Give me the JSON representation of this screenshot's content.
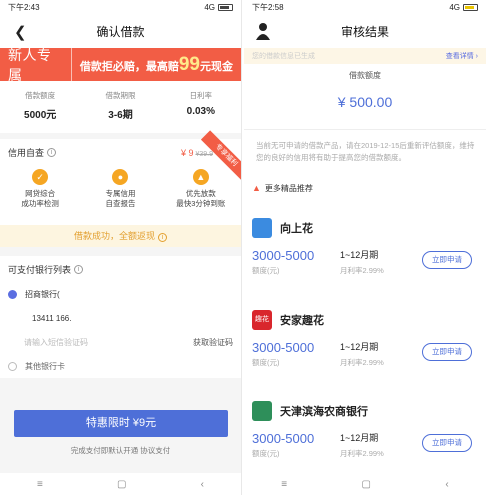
{
  "left": {
    "status": {
      "time": "下午2:43",
      "network": "4G"
    },
    "nav": {
      "title": "确认借款"
    },
    "banner": {
      "tag": "新人专属",
      "msg_prefix": "借款拒必赔，最高赔",
      "msg_amount": "99",
      "msg_suffix": "元现金"
    },
    "stats": [
      {
        "label": "借款额度",
        "value": "5000元"
      },
      {
        "label": "借款期限",
        "value": "3-6期"
      },
      {
        "label": "日利率",
        "value": "0.03%"
      }
    ],
    "credit": {
      "title": "信用自查",
      "price": "¥ 9",
      "old_price": "¥39.9",
      "ribbon": "专享福利",
      "features": [
        {
          "line1": "网贷综合",
          "line2": "成功率检测"
        },
        {
          "line1": "专属信用",
          "line2": "自查报告"
        },
        {
          "line1": "优先放款",
          "line2": "最快3分钟到账"
        }
      ],
      "notice": "借款成功，全额返现"
    },
    "bank": {
      "title": "可支付银行列表",
      "bank_name": "招商银行(",
      "phone": "13411  166.  ",
      "code_placeholder": "请输入短信验证码",
      "get_code": "获取验证码",
      "other": "其他银行卡"
    },
    "pay_button": "特惠限时 ¥9元",
    "agreement": "完成支付即默认开通 协议支付"
  },
  "right": {
    "status": {
      "time": "下午2:58",
      "network": "4G"
    },
    "nav": {
      "title": "审核结果"
    },
    "banner": {
      "left": "您的借款信息已生成",
      "right": "查看详情 ›"
    },
    "amount": {
      "label": "借款额度",
      "value": "¥ 500.00"
    },
    "note": "当前无可申请的借款产品，请在2019-12-15后重新评估额度，维持您的良好的信用将有助于提高您的借款额度。",
    "more": "更多精品推荐",
    "products": [
      {
        "name": "向上花",
        "range": "3000-5000",
        "range_label": "额度(元)",
        "period": "1~12月期",
        "rate": "月利率2.99%",
        "button": "立即申请",
        "logo": "",
        "color": "#3b8be0"
      },
      {
        "name": "安家趣花",
        "range": "3000-5000",
        "range_label": "额度(元)",
        "period": "1~12月期",
        "rate": "月利率2.99%",
        "button": "立即申请",
        "logo": "趣花",
        "color": "#d9262c"
      },
      {
        "name": "天津滨海农商银行",
        "range": "3000-5000",
        "range_label": "额度(元)",
        "period": "1~12月期",
        "rate": "月利率2.99%",
        "button": "立即申请",
        "logo": "",
        "color": "#2e8f5a"
      }
    ]
  },
  "sysnav": {
    "menu": "≡",
    "home": "▢",
    "back": "‹"
  }
}
